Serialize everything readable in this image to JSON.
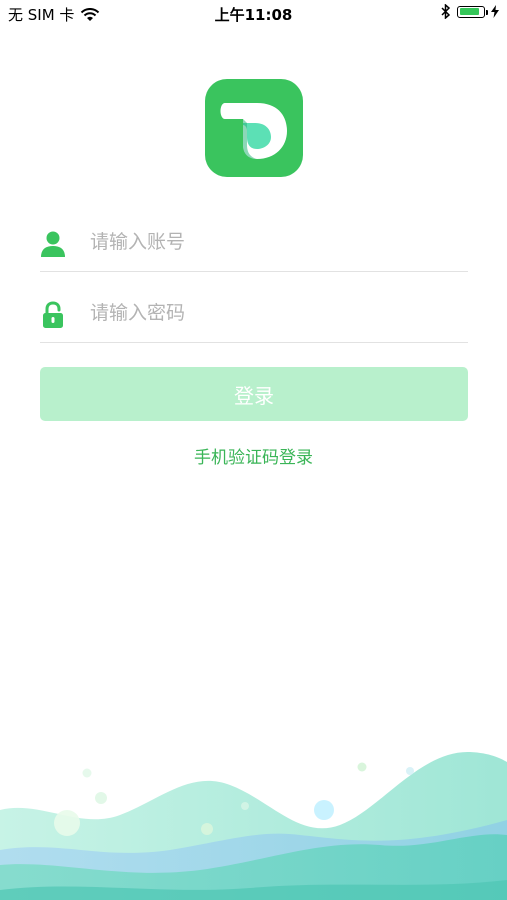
{
  "status_bar": {
    "carrier": "无 SIM 卡",
    "time": "上午11:08",
    "battery_level": 0.85
  },
  "login": {
    "account_placeholder": "请输入账号",
    "password_placeholder": "请输入密码",
    "login_label": "登录",
    "sms_login_label": "手机验证码登录"
  },
  "colors": {
    "brand": "#3ac45e",
    "button_disabled": "#b8f0cc",
    "link": "#3ab557"
  }
}
